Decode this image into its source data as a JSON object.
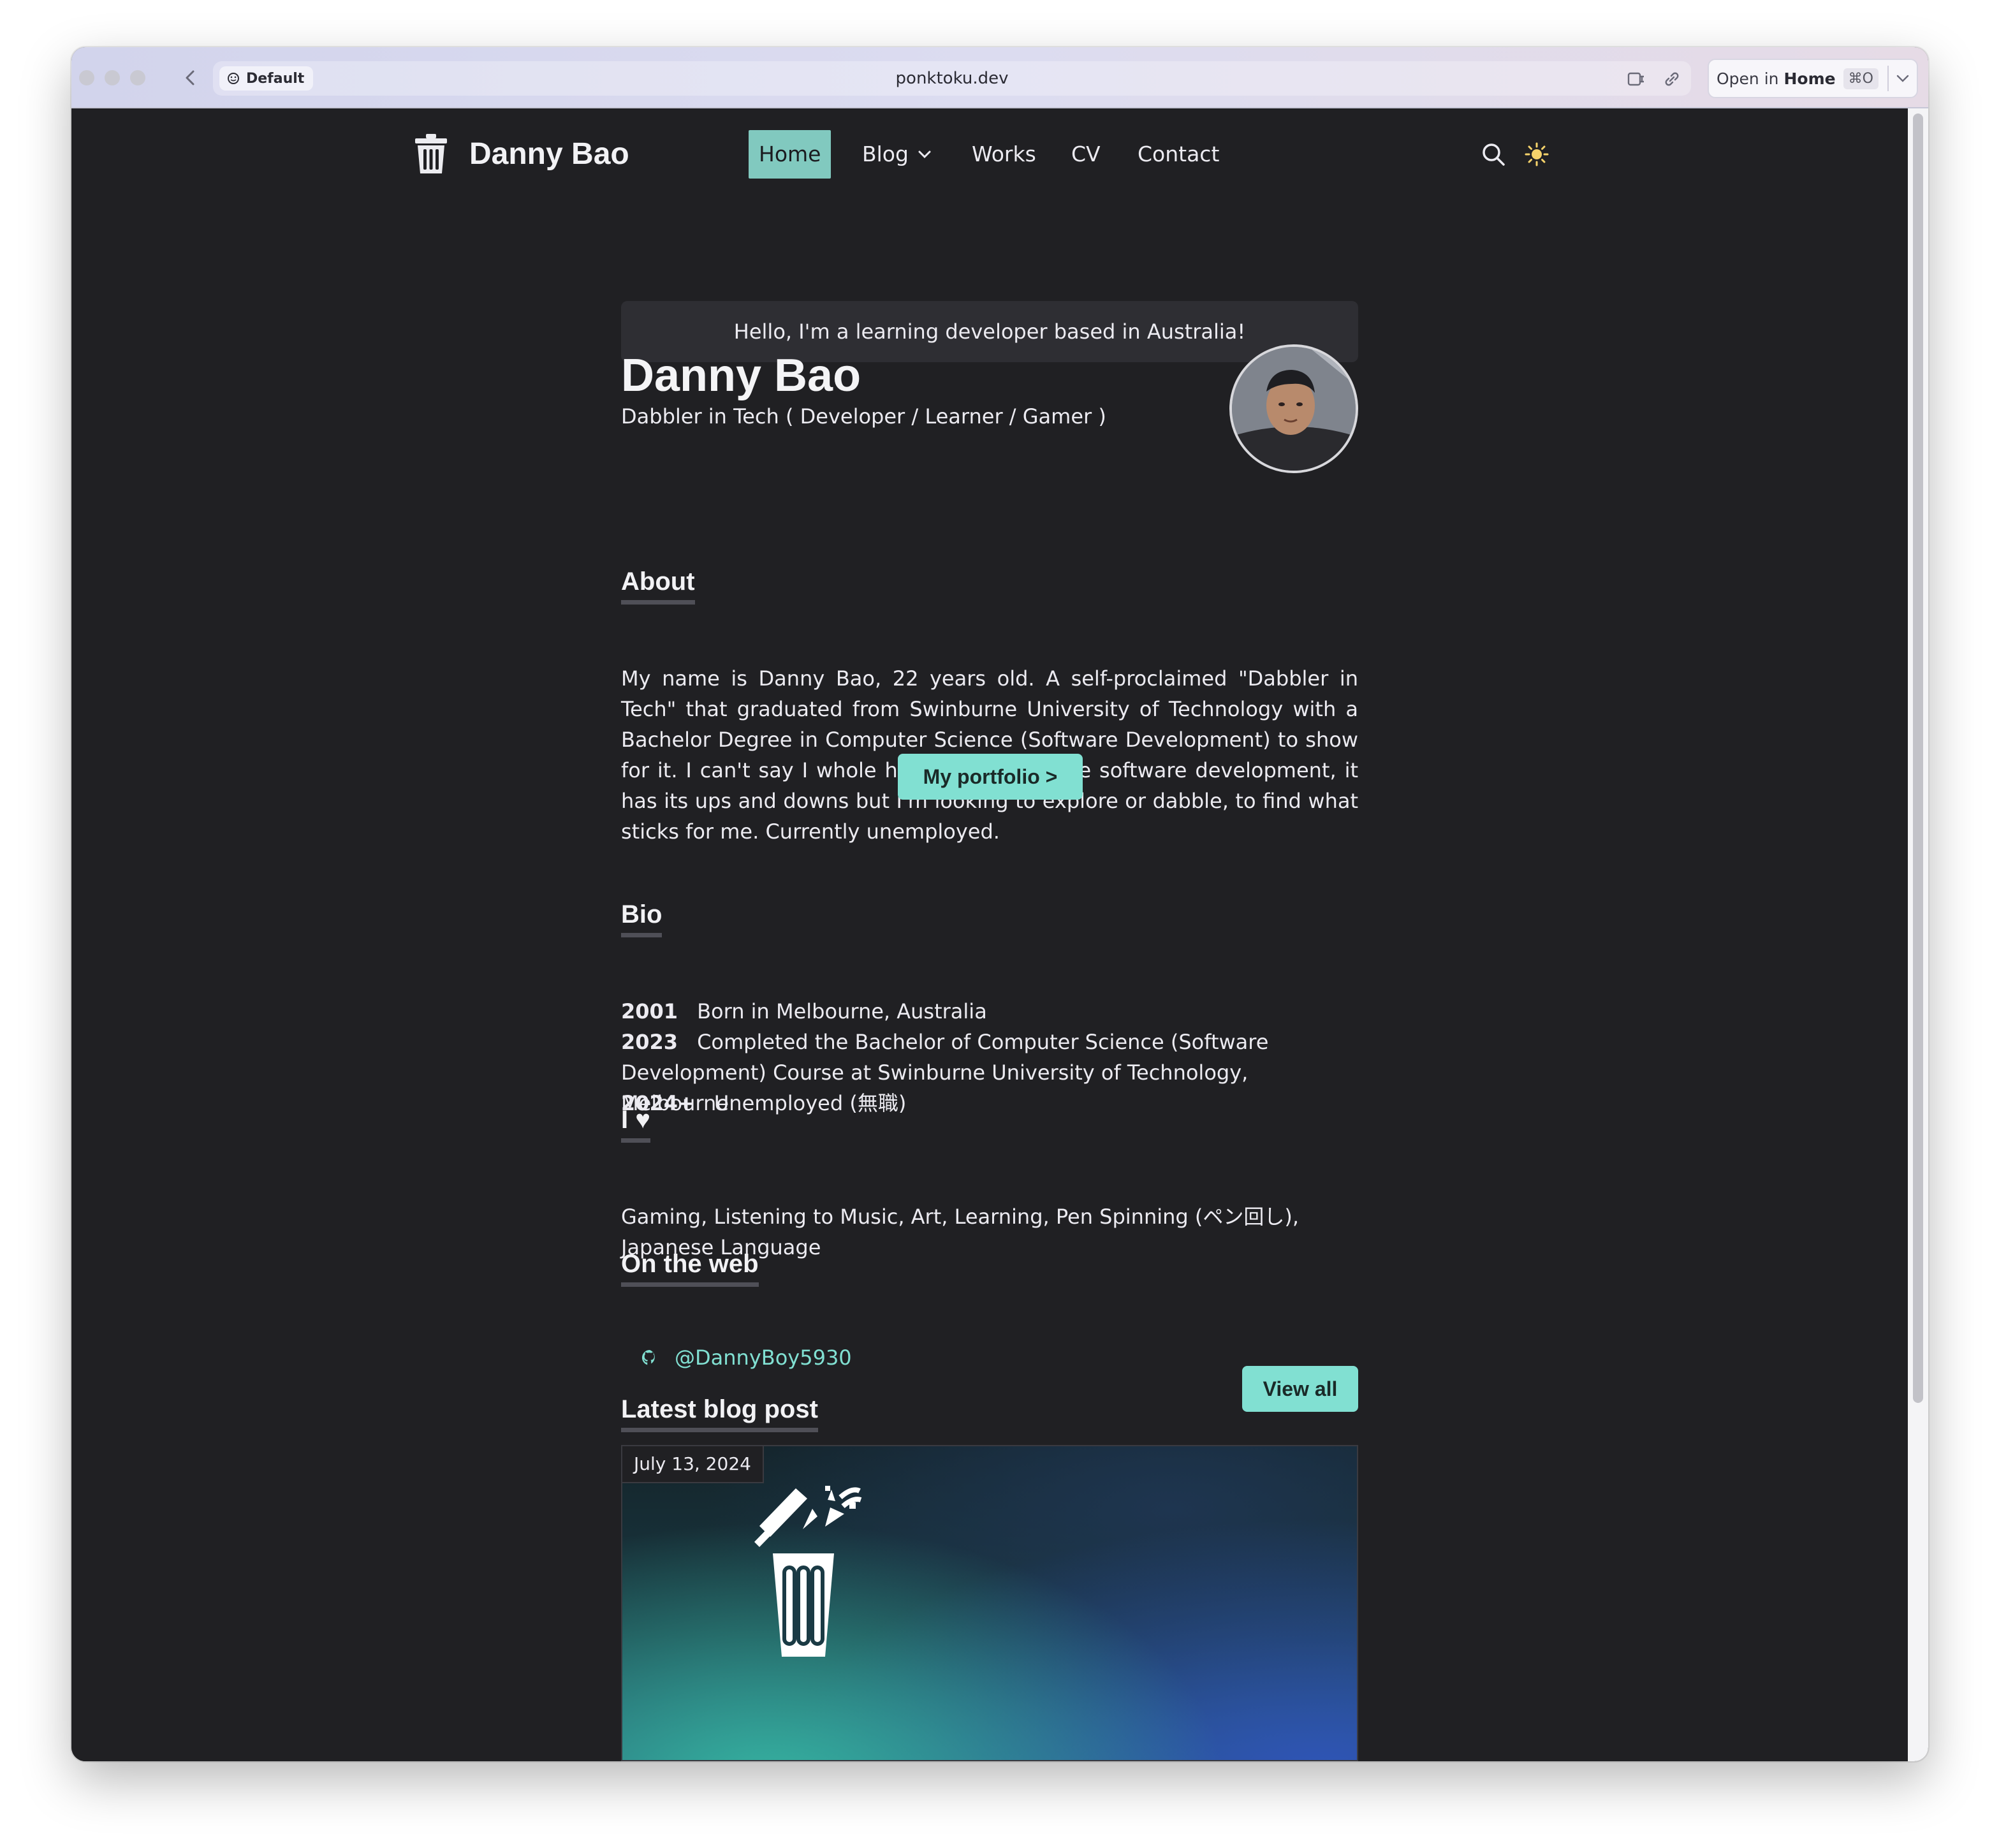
{
  "browser": {
    "profile_label": "Default",
    "url": "ponktoku.dev",
    "open_in_prefix": "Open in ",
    "open_in_target": "Home",
    "open_shortcut": "⌘O"
  },
  "nav": {
    "brand": "Danny Bao",
    "items": {
      "home": "Home",
      "blog": "Blog",
      "works": "Works",
      "cv": "CV",
      "contact": "Contact"
    }
  },
  "hero": {
    "banner": "Hello, I'm a learning developer based in Australia!",
    "name": "Danny Bao",
    "subtitle": "Dabbler in Tech ( Developer / Learner / Gamer )"
  },
  "about": {
    "heading": "About",
    "text": "My name is Danny Bao, 22 years old. A self-proclaimed \"Dabbler in Tech\" that graduated from Swinburne University of Technology with a Bachelor Degree in Computer Science (Software Development) to show for it. I can't say I whole heartedly say I love software development, it has its ups and downs but I'm looking to explore or dabble, to find what sticks for me. Currently unemployed.",
    "portfolio_button": "My portfolio >"
  },
  "bio": {
    "heading": "Bio",
    "entries": [
      {
        "year": "2001",
        "text": "Born in Melbourne, Australia"
      },
      {
        "year": "2023",
        "text": "Completed the Bachelor of Computer Science (Software Development) Course at Swinburne University of Technology, Melbourne"
      },
      {
        "year": "2024+",
        "text": "Unemployed (無職)"
      }
    ]
  },
  "love": {
    "heading": "I ♥",
    "text": "Gaming, Listening to Music, Art, Learning, Pen Spinning (ペン回し), Japanese Language"
  },
  "web": {
    "heading": "On the web",
    "github_handle": "@DannyBoy5930"
  },
  "blog": {
    "heading": "Latest blog post",
    "view_all": "View all",
    "latest_date": "July 13, 2024"
  },
  "colors": {
    "accent": "#81e0d2",
    "nav_active": "#81c9bf",
    "background": "#202023"
  },
  "icons": [
    "trash-can-logo-icon",
    "chevron-down-icon",
    "search-icon",
    "sun-icon",
    "github-icon",
    "back-chevron-icon"
  ]
}
